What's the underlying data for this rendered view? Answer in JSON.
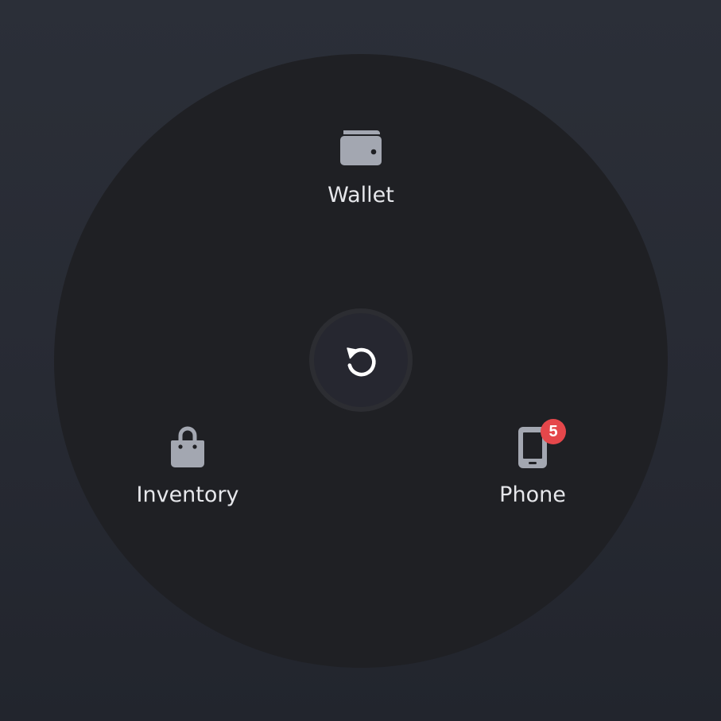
{
  "menu": {
    "items": [
      {
        "id": "wallet",
        "label": "Wallet",
        "icon": "wallet-icon"
      },
      {
        "id": "inventory",
        "label": "Inventory",
        "icon": "shopping-bag-icon"
      },
      {
        "id": "phone",
        "label": "Phone",
        "icon": "phone-icon",
        "badge": "5"
      }
    ],
    "center": {
      "icon": "rotate-ccw-icon"
    }
  },
  "colors": {
    "background": "#282c35",
    "wheel": "#1f2024",
    "icon": "#a3a7b1",
    "label": "#e6e7eb",
    "badge": "#e5474b",
    "center_button": "#262730"
  }
}
